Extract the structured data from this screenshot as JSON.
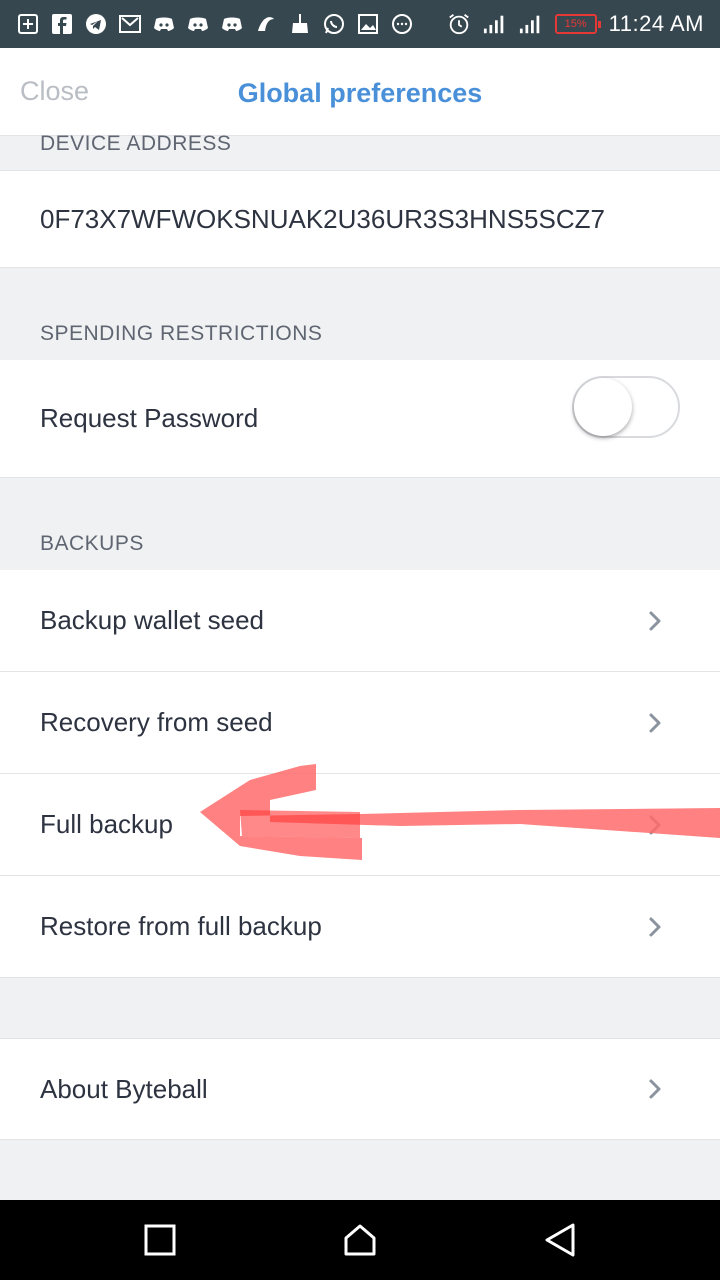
{
  "status_bar": {
    "time": "11:24 AM",
    "battery": "15%",
    "icons": [
      "plus-square-icon",
      "facebook-icon",
      "telegram-icon",
      "mail-icon",
      "discord-icon",
      "discord-icon",
      "discord-icon",
      "app-icon",
      "broom-icon",
      "whatsapp-icon",
      "image-icon",
      "chat-icon",
      "alarm-icon",
      "signal-icon",
      "signal-hplus-icon",
      "battery-icon"
    ]
  },
  "header": {
    "close_label": "Close",
    "title": "Global preferences"
  },
  "device_address": {
    "section_label": "DEVICE ADDRESS",
    "value": "0F73X7WFWOKSNUAK2U36UR3S3HNS5SCZ7"
  },
  "spending": {
    "section_label": "SPENDING RESTRICTIONS",
    "request_password_label": "Request Password",
    "request_password_enabled": false
  },
  "backups": {
    "section_label": "BACKUPS",
    "items": [
      {
        "label": "Backup wallet seed"
      },
      {
        "label": "Recovery from seed"
      },
      {
        "label": "Full backup"
      },
      {
        "label": "Restore from full backup"
      }
    ]
  },
  "about": {
    "label": "About Byteball"
  },
  "colors": {
    "accent": "#4a90d9",
    "annotation_arrow": "#ff6b6b",
    "status_bar": "#37474f"
  }
}
